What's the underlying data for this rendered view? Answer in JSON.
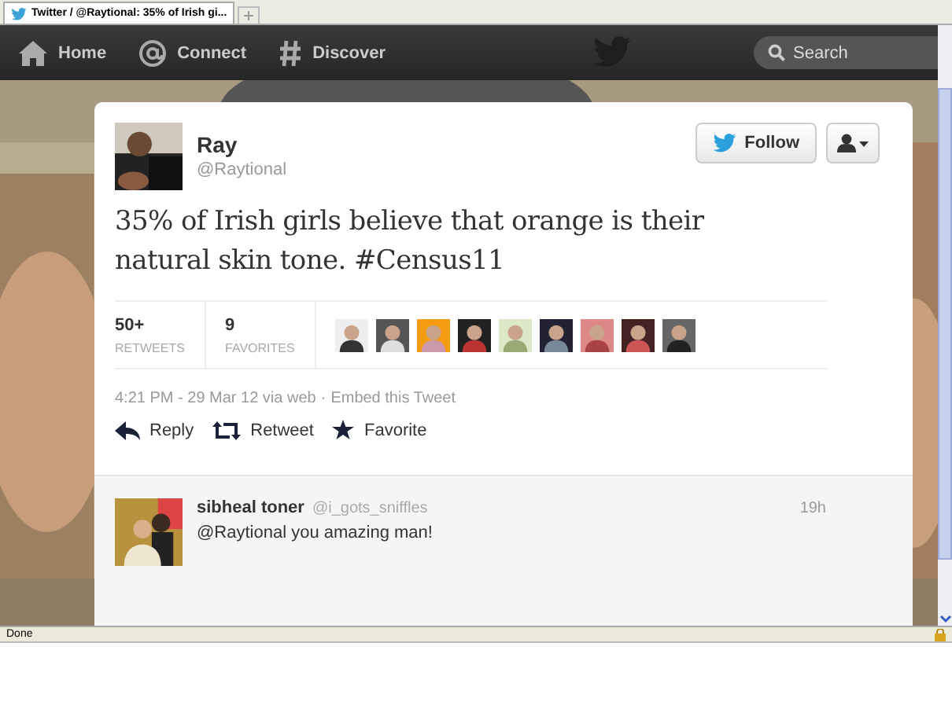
{
  "browser": {
    "tab_title": "Twitter / @Raytional: 35% of Irish gi...",
    "status": "Done"
  },
  "nav": {
    "items": [
      {
        "label": "Home"
      },
      {
        "label": "Connect"
      },
      {
        "label": "Discover"
      }
    ],
    "search_placeholder": "Search"
  },
  "tweet": {
    "name": "Ray",
    "handle": "@Raytional",
    "follow_label": "Follow",
    "text": "35% of Irish girls believe that orange is their natural skin tone. #Census11",
    "stats": [
      {
        "value": "50+",
        "label": "RETWEETS"
      },
      {
        "value": "9",
        "label": "FAVORITES"
      }
    ],
    "timestamp": "4:21 PM - 29 Mar 12 via web",
    "separator": "·",
    "embed_link": "Embed this Tweet",
    "actions": [
      {
        "label": "Reply"
      },
      {
        "label": "Retweet"
      },
      {
        "label": "Favorite"
      }
    ]
  },
  "replies": [
    {
      "name": "sibheal toner",
      "handle": "@i_gots_sniffles",
      "time": "19h",
      "mention": "@Raytional",
      "text": "you amazing man!"
    }
  ]
}
